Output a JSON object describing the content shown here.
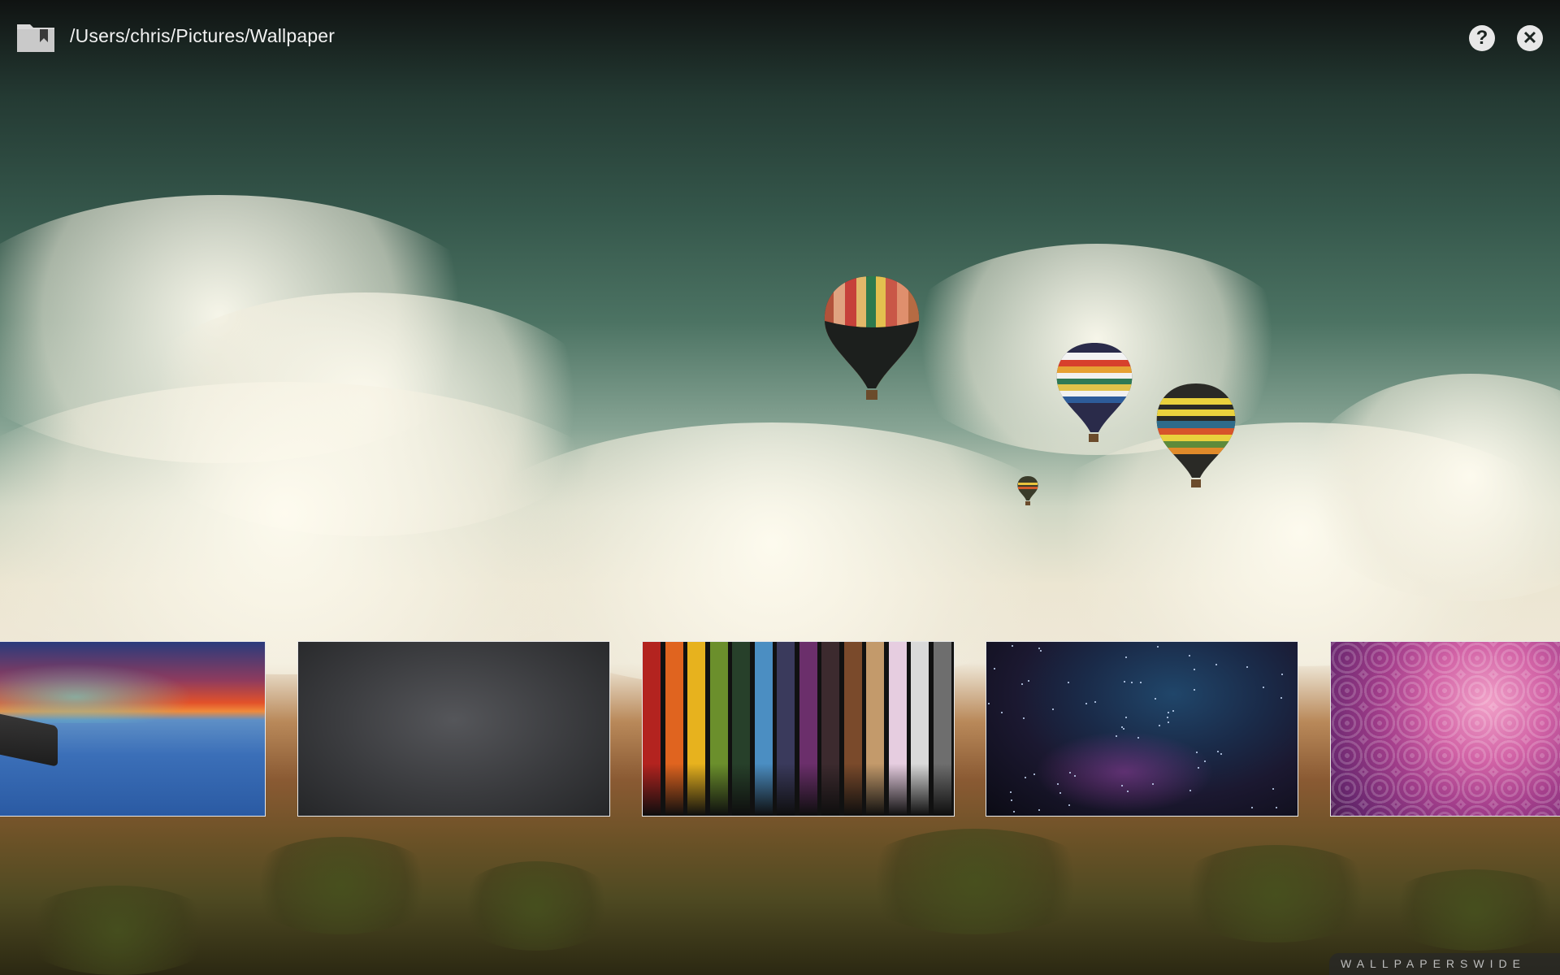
{
  "header": {
    "folder_icon": "folder-bookmark-icon",
    "path": "/Users/chris/Pictures/Wallpaper",
    "help_icon": "help-icon",
    "help_glyph": "?",
    "close_icon": "close-icon",
    "close_glyph": "✕"
  },
  "background": {
    "subject": "hot air balloons over clouds and desert",
    "watermark": "WALLPAPERSWIDE"
  },
  "thumbnails": [
    {
      "name": "thumbnail-sunset-sea"
    },
    {
      "name": "thumbnail-dark-pattern"
    },
    {
      "name": "thumbnail-color-stripes"
    },
    {
      "name": "thumbnail-starfield"
    },
    {
      "name": "thumbnail-pink-swirl"
    }
  ],
  "colors": {
    "stripe_colors": [
      "#b3231f",
      "#e0641f",
      "#e7b21e",
      "#6b8f2c",
      "#27402a",
      "#4b8ec2",
      "#3a3a5c",
      "#6b2f6b",
      "#3c2a2e",
      "#7a4a2b",
      "#c39a6b",
      "#e6cde0",
      "#d9d9d9",
      "#6e6e6e"
    ]
  }
}
